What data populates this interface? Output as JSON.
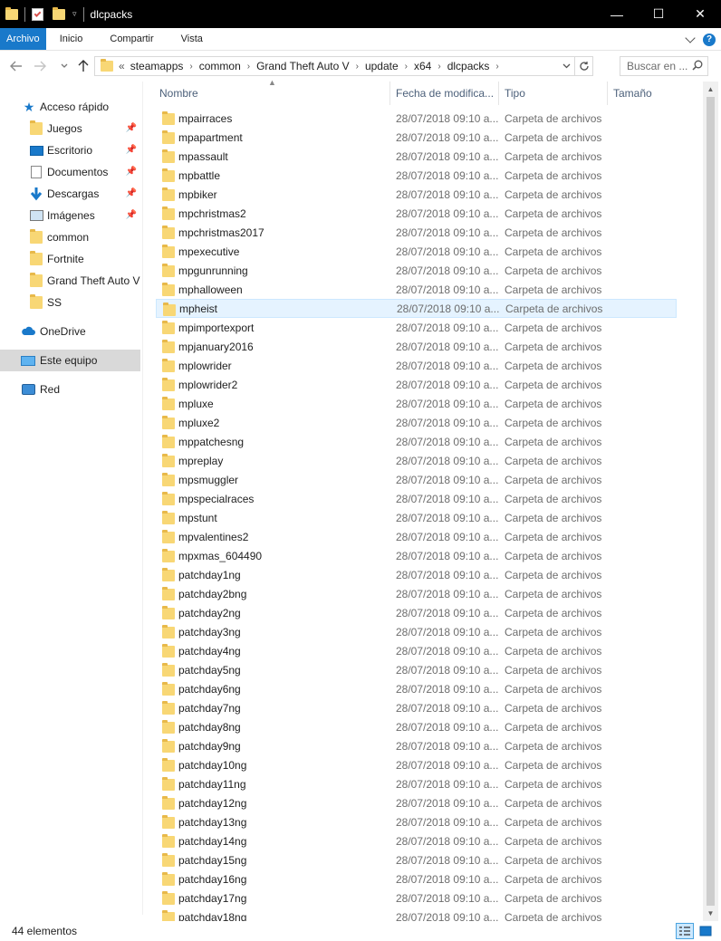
{
  "window": {
    "title": "dlcpacks",
    "controls": {
      "minimize": "—",
      "maximize": "☐",
      "close": "✕"
    }
  },
  "ribbon": {
    "tabs": [
      {
        "label": "Archivo",
        "active": true
      },
      {
        "label": "Inicio",
        "active": false
      },
      {
        "label": "Compartir",
        "active": false
      },
      {
        "label": "Vista",
        "active": false
      }
    ],
    "help": "?"
  },
  "address": {
    "overflow": "«",
    "crumbs": [
      "steamapps",
      "common",
      "Grand Theft Auto V",
      "update",
      "x64",
      "dlcpacks"
    ],
    "search_placeholder": "Buscar en ..."
  },
  "sidebar": {
    "items": [
      {
        "label": "Acceso rápido",
        "icon": "star-icon",
        "pinned": false
      },
      {
        "label": "Juegos",
        "icon": "folder-icon",
        "pinned": true
      },
      {
        "label": "Escritorio",
        "icon": "desktop-icon",
        "pinned": true
      },
      {
        "label": "Documentos",
        "icon": "document-icon",
        "pinned": true
      },
      {
        "label": "Descargas",
        "icon": "download-icon",
        "pinned": true
      },
      {
        "label": "Imágenes",
        "icon": "pictures-icon",
        "pinned": true
      },
      {
        "label": "common",
        "icon": "folder-icon",
        "pinned": false
      },
      {
        "label": "Fortnite",
        "icon": "folder-icon",
        "pinned": false
      },
      {
        "label": "Grand Theft Auto V",
        "icon": "folder-icon",
        "pinned": false
      },
      {
        "label": "SS",
        "icon": "folder-icon",
        "pinned": false
      },
      {
        "label": "OneDrive",
        "icon": "cloud-icon",
        "pinned": false
      },
      {
        "label": "Este equipo",
        "icon": "computer-icon",
        "pinned": false,
        "selected": true
      },
      {
        "label": "Red",
        "icon": "network-icon",
        "pinned": false
      }
    ]
  },
  "columns": {
    "name": "Nombre",
    "date": "Fecha de modifica...",
    "type": "Tipo",
    "size": "Tamaño"
  },
  "files": [
    {
      "name": "mpairraces",
      "date": "28/07/2018 09:10 a...",
      "type": "Carpeta de archivos"
    },
    {
      "name": "mpapartment",
      "date": "28/07/2018 09:10 a...",
      "type": "Carpeta de archivos"
    },
    {
      "name": "mpassault",
      "date": "28/07/2018 09:10 a...",
      "type": "Carpeta de archivos"
    },
    {
      "name": "mpbattle",
      "date": "28/07/2018 09:10 a...",
      "type": "Carpeta de archivos"
    },
    {
      "name": "mpbiker",
      "date": "28/07/2018 09:10 a...",
      "type": "Carpeta de archivos"
    },
    {
      "name": "mpchristmas2",
      "date": "28/07/2018 09:10 a...",
      "type": "Carpeta de archivos"
    },
    {
      "name": "mpchristmas2017",
      "date": "28/07/2018 09:10 a...",
      "type": "Carpeta de archivos"
    },
    {
      "name": "mpexecutive",
      "date": "28/07/2018 09:10 a...",
      "type": "Carpeta de archivos"
    },
    {
      "name": "mpgunrunning",
      "date": "28/07/2018 09:10 a...",
      "type": "Carpeta de archivos"
    },
    {
      "name": "mphalloween",
      "date": "28/07/2018 09:10 a...",
      "type": "Carpeta de archivos"
    },
    {
      "name": "mpheist",
      "date": "28/07/2018 09:10 a...",
      "type": "Carpeta de archivos",
      "hover": true
    },
    {
      "name": "mpimportexport",
      "date": "28/07/2018 09:10 a...",
      "type": "Carpeta de archivos"
    },
    {
      "name": "mpjanuary2016",
      "date": "28/07/2018 09:10 a...",
      "type": "Carpeta de archivos"
    },
    {
      "name": "mplowrider",
      "date": "28/07/2018 09:10 a...",
      "type": "Carpeta de archivos"
    },
    {
      "name": "mplowrider2",
      "date": "28/07/2018 09:10 a...",
      "type": "Carpeta de archivos"
    },
    {
      "name": "mpluxe",
      "date": "28/07/2018 09:10 a...",
      "type": "Carpeta de archivos"
    },
    {
      "name": "mpluxe2",
      "date": "28/07/2018 09:10 a...",
      "type": "Carpeta de archivos"
    },
    {
      "name": "mppatchesng",
      "date": "28/07/2018 09:10 a...",
      "type": "Carpeta de archivos"
    },
    {
      "name": "mpreplay",
      "date": "28/07/2018 09:10 a...",
      "type": "Carpeta de archivos"
    },
    {
      "name": "mpsmuggler",
      "date": "28/07/2018 09:10 a...",
      "type": "Carpeta de archivos"
    },
    {
      "name": "mpspecialraces",
      "date": "28/07/2018 09:10 a...",
      "type": "Carpeta de archivos"
    },
    {
      "name": "mpstunt",
      "date": "28/07/2018 09:10 a...",
      "type": "Carpeta de archivos"
    },
    {
      "name": "mpvalentines2",
      "date": "28/07/2018 09:10 a...",
      "type": "Carpeta de archivos"
    },
    {
      "name": "mpxmas_604490",
      "date": "28/07/2018 09:10 a...",
      "type": "Carpeta de archivos"
    },
    {
      "name": "patchday1ng",
      "date": "28/07/2018 09:10 a...",
      "type": "Carpeta de archivos"
    },
    {
      "name": "patchday2bng",
      "date": "28/07/2018 09:10 a...",
      "type": "Carpeta de archivos"
    },
    {
      "name": "patchday2ng",
      "date": "28/07/2018 09:10 a...",
      "type": "Carpeta de archivos"
    },
    {
      "name": "patchday3ng",
      "date": "28/07/2018 09:10 a...",
      "type": "Carpeta de archivos"
    },
    {
      "name": "patchday4ng",
      "date": "28/07/2018 09:10 a...",
      "type": "Carpeta de archivos"
    },
    {
      "name": "patchday5ng",
      "date": "28/07/2018 09:10 a...",
      "type": "Carpeta de archivos"
    },
    {
      "name": "patchday6ng",
      "date": "28/07/2018 09:10 a...",
      "type": "Carpeta de archivos"
    },
    {
      "name": "patchday7ng",
      "date": "28/07/2018 09:10 a...",
      "type": "Carpeta de archivos"
    },
    {
      "name": "patchday8ng",
      "date": "28/07/2018 09:10 a...",
      "type": "Carpeta de archivos"
    },
    {
      "name": "patchday9ng",
      "date": "28/07/2018 09:10 a...",
      "type": "Carpeta de archivos"
    },
    {
      "name": "patchday10ng",
      "date": "28/07/2018 09:10 a...",
      "type": "Carpeta de archivos"
    },
    {
      "name": "patchday11ng",
      "date": "28/07/2018 09:10 a...",
      "type": "Carpeta de archivos"
    },
    {
      "name": "patchday12ng",
      "date": "28/07/2018 09:10 a...",
      "type": "Carpeta de archivos"
    },
    {
      "name": "patchday13ng",
      "date": "28/07/2018 09:10 a...",
      "type": "Carpeta de archivos"
    },
    {
      "name": "patchday14ng",
      "date": "28/07/2018 09:10 a...",
      "type": "Carpeta de archivos"
    },
    {
      "name": "patchday15ng",
      "date": "28/07/2018 09:10 a...",
      "type": "Carpeta de archivos"
    },
    {
      "name": "patchday16ng",
      "date": "28/07/2018 09:10 a...",
      "type": "Carpeta de archivos"
    },
    {
      "name": "patchday17ng",
      "date": "28/07/2018 09:10 a...",
      "type": "Carpeta de archivos"
    },
    {
      "name": "patchday18ng",
      "date": "28/07/2018 09:10 a...",
      "type": "Carpeta de archivos"
    }
  ],
  "status": {
    "count": "44 elementos"
  },
  "colors": {
    "accent": "#1979ca",
    "folder": "#f8d775",
    "hover_row": "#e5f3ff",
    "sidebar_selected": "#d9d9d9"
  }
}
